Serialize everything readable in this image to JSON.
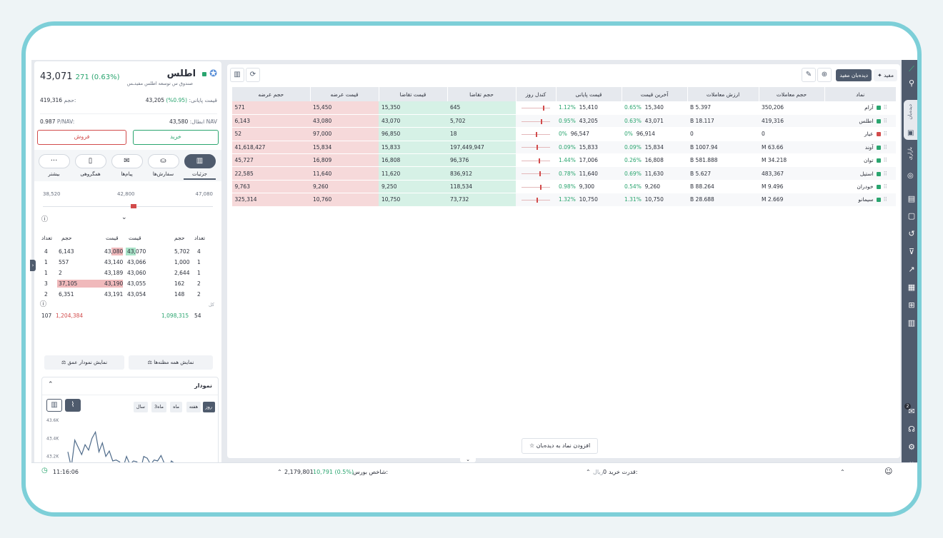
{
  "colors": {
    "accent": "#4f5b6d",
    "buy": "#2aa56f",
    "sell": "#d24b4b",
    "frame": "#7dcfd8"
  },
  "sidebar": {
    "tab_watchlist": "دیده‌بان",
    "tab_market": "بازاری",
    "chat_badge": "2",
    "icons": [
      "logo-icon",
      "search-icon",
      "watchlist-icon",
      "market-icon",
      "ipo-icon",
      "portfolio-icon",
      "history-icon",
      "filter-icon",
      "report-icon",
      "grid-icon",
      "calculator-icon",
      "chart-icon",
      "chat-icon",
      "headset-icon",
      "settings-icon",
      "apps-icon"
    ]
  },
  "watchlist": {
    "title_button": "مفید",
    "selected_list": "دیده‌بان مفید",
    "add_symbol": "افزودن نماد به دیده‌بان",
    "columns": [
      "نماد",
      "حجم معاملات",
      "ارزش معاملات",
      "آخرین قیمت",
      "قیمت پایانی",
      "کندل روز",
      "حجم تقاضا",
      "قیمت تقاضا",
      "قیمت عرضه",
      "حجم عرضه"
    ],
    "rows": [
      {
        "symbol": "آرام",
        "status": "#2aa56f",
        "volume": "350,206",
        "value": "5.397 B",
        "last": "15,340",
        "last_pct": "0.65%",
        "close": "15,410",
        "close_pct": "1.12%",
        "bq": "645",
        "bp": "15,350",
        "sp": "15,450",
        "sq": "571",
        "c": 0.7
      },
      {
        "symbol": "اطلس",
        "status": "#2aa56f",
        "volume": "419,316",
        "value": "18.117 B",
        "last": "43,071",
        "last_pct": "0.63%",
        "close": "43,205",
        "close_pct": "0.95%",
        "bq": "5,702",
        "bp": "43,070",
        "sp": "43,080",
        "sq": "6,143",
        "c": 0.65
      },
      {
        "symbol": "عیار",
        "status": "#d24b4b",
        "volume": "0",
        "value": "0",
        "last": "96,914",
        "last_pct": "0%",
        "close": "96,547",
        "close_pct": "0%",
        "bq": "18",
        "bp": "96,850",
        "sp": "97,000",
        "sq": "52",
        "c": 0.5
      },
      {
        "symbol": "آوند",
        "status": "#2aa56f",
        "volume": "63.66 M",
        "value": "1007.94 B",
        "last": "15,834",
        "last_pct": "0.09%",
        "close": "15,833",
        "close_pct": "0.09%",
        "bq": "197,449,947",
        "bp": "15,833",
        "sp": "15,834",
        "sq": "41,618,427",
        "c": 0.52
      },
      {
        "symbol": "توان",
        "status": "#2aa56f",
        "volume": "34.218 M",
        "value": "581.888 B",
        "last": "16,808",
        "last_pct": "0.26%",
        "close": "17,006",
        "close_pct": "1.44%",
        "bq": "96,376",
        "bp": "16,808",
        "sp": "16,809",
        "sq": "45,727",
        "c": 0.58
      },
      {
        "symbol": "استیل",
        "status": "#2aa56f",
        "volume": "483,367",
        "value": "5.627 B",
        "last": "11,630",
        "last_pct": "0.69%",
        "close": "11,640",
        "close_pct": "0.78%",
        "bq": "836,912",
        "bp": "11,620",
        "sp": "11,640",
        "sq": "22,585",
        "c": 0.6
      },
      {
        "symbol": "خودران",
        "status": "#2aa56f",
        "volume": "9.496 M",
        "value": "88.264 B",
        "last": "9,260",
        "last_pct": "0.54%",
        "close": "9,300",
        "close_pct": "0.98%",
        "bq": "118,534",
        "bp": "9,250",
        "sp": "9,260",
        "sq": "9,763",
        "c": 0.62
      },
      {
        "symbol": "سیمانو",
        "status": "#2aa56f",
        "volume": "2.669 M",
        "value": "28.688 B",
        "last": "10,750",
        "last_pct": "1.31%",
        "close": "10,750",
        "close_pct": "1.32%",
        "bq": "73,732",
        "bp": "10,750",
        "sp": "10,760",
        "sq": "325,314",
        "c": 0.52
      }
    ]
  },
  "details": {
    "symbol": "اطلس",
    "fund": "صندوق س توسعه اطلس مفیدـس",
    "price": "43,071",
    "price_change": "271 (0.63%)",
    "close_label": "قیمت پایانی:",
    "close_value": "43,205",
    "close_pct": "(0.95%)",
    "volume_label": "حجم:",
    "volume_value": "419,316",
    "nav_label": "NAV ابطال:",
    "nav_value": "43,580",
    "pnav_label": "P/NAV:",
    "pnav_value": "0.987",
    "buy": "خرید",
    "sell": "فروش",
    "tabs": [
      "جزئیات",
      "سفارش‌ها",
      "پیام‌ها",
      "همگروهی",
      "بیشتر"
    ],
    "range": {
      "low": "38,520",
      "mid": "42,800",
      "high": "47,080"
    },
    "ob_headers": {
      "count": "تعداد",
      "volume": "حجم",
      "price": "قیمت"
    },
    "orderbook": [
      {
        "sc": "4",
        "sv": "6,143",
        "sp": "43,080",
        "bp": "43,070",
        "bv": "5,702",
        "bc": "4"
      },
      {
        "sc": "1",
        "sv": "557",
        "sp": "43,140",
        "bp": "43,066",
        "bv": "1,000",
        "bc": "1"
      },
      {
        "sc": "1",
        "sv": "2",
        "sp": "43,189",
        "bp": "43,060",
        "bv": "2,644",
        "bc": "1"
      },
      {
        "sc": "3",
        "sv": "37,105",
        "sp": "43,190",
        "bp": "43,055",
        "bv": "162",
        "bc": "2"
      },
      {
        "sc": "2",
        "sv": "6,351",
        "sp": "43,191",
        "bp": "43,054",
        "bv": "148",
        "bc": "2"
      }
    ],
    "total_label": "کل",
    "total_sell_count": "107",
    "total_sell_vol": "1,204,384",
    "total_buy_vol": "1,098,315",
    "total_buy_count": "54",
    "show_all": "نمایش همه مظنه‌ها",
    "show_depth": "نمایش نمودار عمق",
    "chart_title": "نمودار",
    "periods": [
      "روز",
      "هفته",
      "ماه",
      "3ماه",
      "سال"
    ],
    "yticks": [
      "43.6K",
      "43.4K",
      "43.2K",
      "43K"
    ]
  },
  "chart_data": {
    "type": "line",
    "ylim": [
      43000,
      43600
    ],
    "yticks": [
      "43.6K",
      "43.4K",
      "43.2K",
      "43K"
    ],
    "values": [
      43250,
      43080,
      43380,
      43300,
      43220,
      43330,
      43270,
      43400,
      43470,
      43250,
      43350,
      43200,
      43260,
      43150,
      43160,
      43140,
      43080,
      43200,
      43110,
      43150,
      43140,
      43040,
      43200,
      43180,
      43110,
      43160,
      43150,
      43210,
      43120,
      43030,
      43150,
      43120,
      43100,
      43120,
      43080,
      43120,
      43080,
      43050,
      43060,
      43060,
      43050,
      43060
    ]
  },
  "bottom": {
    "time": "11:16:06",
    "index_label": "شاخص بورس:",
    "index_value": "2,179,801",
    "index_change": "10,791 (0.5%)",
    "buying_power_label": "قدرت خرید:",
    "buying_power_value": "0",
    "currency": "ریال"
  }
}
